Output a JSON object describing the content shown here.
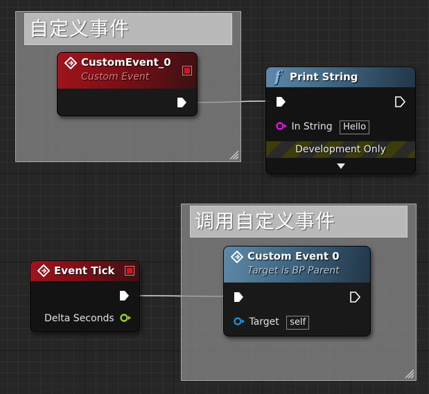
{
  "comments": {
    "define_event_title": "自定义事件",
    "call_event_title": "调用自定义事件"
  },
  "nodes": {
    "custom_event_def": {
      "title": "CustomEvent_0",
      "subtitle": "Custom Event"
    },
    "print_string": {
      "title": "Print String",
      "func_icon": "f",
      "in_string_label": "In String",
      "in_string_value": "Hello",
      "dev_only_label": "Development Only"
    },
    "event_tick": {
      "title": "Event Tick",
      "delta_label": "Delta Seconds"
    },
    "call_custom_event": {
      "title": "Custom Event 0",
      "subtitle": "Target is BP Parent",
      "target_label": "Target",
      "target_value": "self"
    }
  },
  "colors": {
    "event_header": "#a0141c",
    "function_header": "#5e89a8",
    "string_pin": "#e40fe4",
    "float_pin": "#9cd126",
    "object_pin": "#1a8fdb",
    "exec_pin": "#ffffff"
  },
  "icons": [
    "event-diamond-icon",
    "function-icon",
    "delegate-pin-icon",
    "exec-pin-icon",
    "expand-arrow-icon",
    "resize-grip-icon"
  ]
}
